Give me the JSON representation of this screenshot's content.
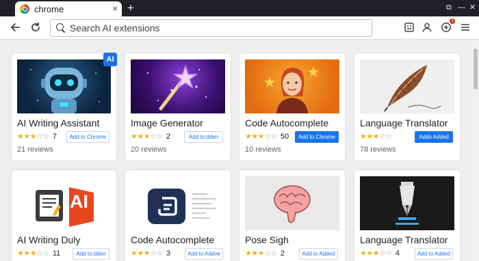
{
  "browser": {
    "tab_title": "chrome",
    "tab_close": "×",
    "new_tab": "+",
    "window_controls": [
      "⧉",
      "—",
      "✕"
    ]
  },
  "toolbar": {
    "search_placeholder": "Search AI extensions",
    "back_icon": "arrow-left",
    "reload_icon": "reload",
    "extension_badge_count": "1"
  },
  "extensions": [
    {
      "title": "AI Writing Assistant",
      "rating": 3,
      "count": "7",
      "reviews": "21 reviews",
      "button": "Add to Chrome",
      "button_style": "outline",
      "badge": "AI"
    },
    {
      "title": "Image Generator",
      "rating": 3,
      "count": "2",
      "reviews": "20 reviews",
      "button": "Add to:dden",
      "button_style": "outline"
    },
    {
      "title": "Code Autocomplete",
      "rating": 3,
      "count": "50",
      "reviews": "10 reviews",
      "button": "Add to Chrome",
      "button_style": "filled"
    },
    {
      "title": "Language Translator",
      "rating": 3,
      "count": "",
      "reviews": "78 reviews",
      "button": "Addo Added",
      "button_style": "filled"
    },
    {
      "title": "AI Writing Duly",
      "rating": 3,
      "count": "11",
      "reviews": "",
      "button": "Add to:dden",
      "button_style": "outline",
      "logo_text": "AI"
    },
    {
      "title": "Code Autocomplete",
      "rating": 3,
      "count": "3",
      "reviews": "",
      "button": "Add to Addve",
      "button_style": "outline"
    },
    {
      "title": "Pose Sigh",
      "rating": 3,
      "count": "2",
      "reviews": "",
      "button": "Add to Added",
      "button_style": "outline"
    },
    {
      "title": "Language Translator",
      "rating": 3,
      "count": "4",
      "reviews": "",
      "button": "Add to Added",
      "button_style": "outline"
    }
  ],
  "colors": {
    "accent": "#1a73e8",
    "star": "#f2b01e",
    "tabstrip": "#202124"
  }
}
